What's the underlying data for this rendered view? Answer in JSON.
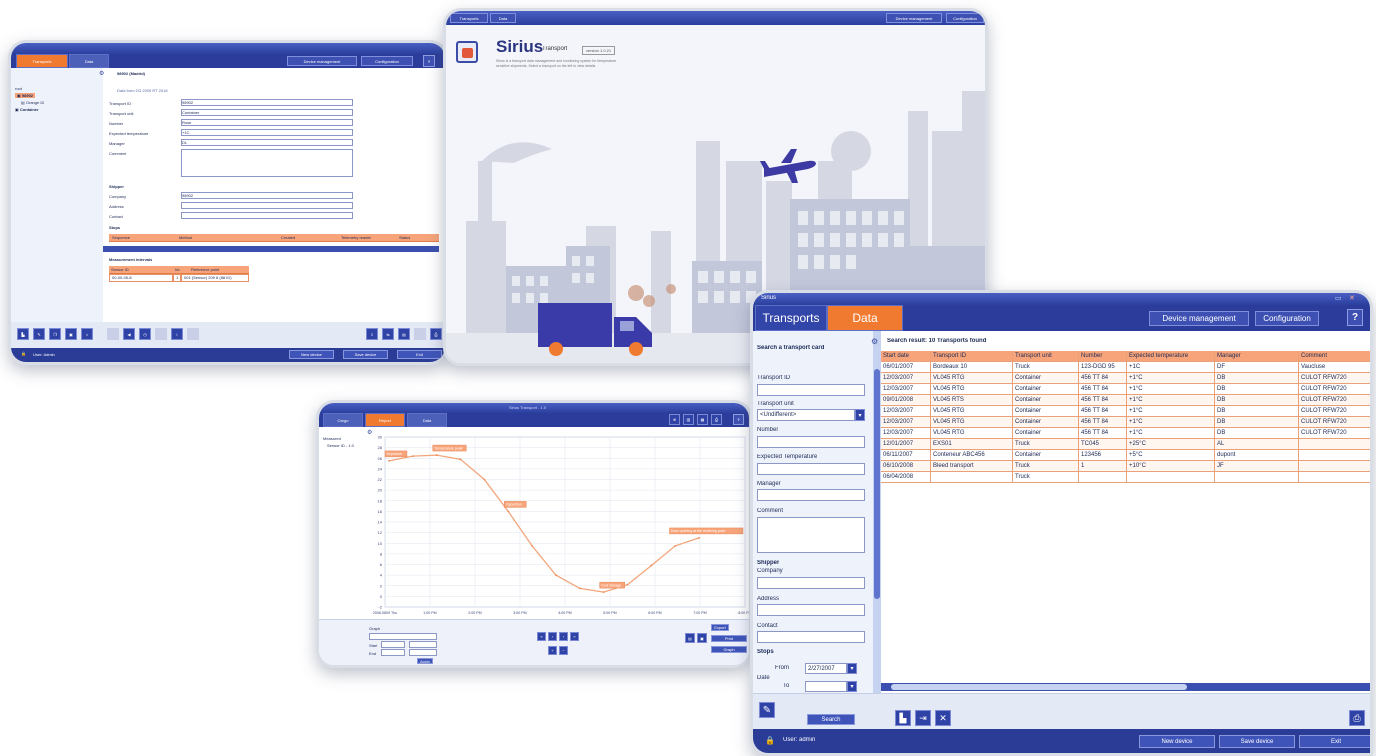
{
  "w1": {
    "tabs": [
      {
        "label": "Transports",
        "active": true
      },
      {
        "label": "Data",
        "active": false
      }
    ],
    "nav_buttons": [
      "Device management",
      "Configuration"
    ],
    "help": "?",
    "tree": [
      {
        "label": "root"
      },
      {
        "label": "98902"
      },
      {
        "label": "Orange ID"
      },
      {
        "label": "Container"
      }
    ],
    "form_title": "98902 (Madrid)",
    "form_subtitle": "Data from 2/3 2009 RT 2018",
    "fields": [
      {
        "label": "Transport ID",
        "value": "98902"
      },
      {
        "label": "Transport unit",
        "value": "Container"
      },
      {
        "label": "Number",
        "value": "Rose"
      },
      {
        "label": "Expected temperature",
        "value": "+1C"
      },
      {
        "label": "Manager",
        "value": "DL"
      },
      {
        "label": "Comment",
        "value": ""
      }
    ],
    "shipper_title": "Shipper",
    "shipper_fields": [
      {
        "label": "Company",
        "value": "98902"
      },
      {
        "label": "Address",
        "value": ""
      },
      {
        "label": "Contact",
        "value": ""
      }
    ],
    "stops_title": "Stops",
    "stops_headers": [
      "Sequence",
      "Method",
      "Created",
      "Telemetry reader",
      "Status"
    ],
    "measurement_title": "Measurement intervals",
    "measurement_headers": [
      "Sensor ID",
      "Int.",
      "Reference point"
    ],
    "measurement_row": [
      "00-00-05-8",
      "1",
      "001 (Sensor) 209 8 (88 ID)"
    ],
    "status_user": "User: Admin",
    "status_buttons": [
      "New device",
      "Save device",
      "Exit"
    ]
  },
  "w2": {
    "nav_left": [
      "Transports",
      "Data"
    ],
    "nav_right": [
      "Device management",
      "Configuration"
    ],
    "brand": "Sirius",
    "brand_sub": "Transport",
    "version": "version 1.0.21",
    "description": "Sirius is a transport data management and monitoring system for temperature sensitive shipments. Select a transport on the left to view details."
  },
  "w3": {
    "tabs": [
      {
        "label": "Cargo",
        "active": false
      },
      {
        "label": "Report",
        "active": true
      },
      {
        "label": "Data",
        "active": false
      }
    ],
    "title": "Sirius Transport - 1.0",
    "tree": [
      "Measured",
      "Sensor ID - 1.0"
    ],
    "y_ticks": [
      "30",
      "28",
      "26",
      "24",
      "22",
      "20",
      "18",
      "16",
      "14",
      "12",
      "10",
      "8",
      "6",
      "4",
      "2",
      "0",
      "-2"
    ],
    "x_ticks": [
      "2008-0809 Thu",
      "1:00 PM",
      "2:00 PM",
      "3:00 PM",
      "4:00 PM",
      "5:00 PM",
      "6:00 PM",
      "7:00 PM",
      "8:00 PM"
    ],
    "annotations": [
      "Departure",
      "Temperature peak",
      "Inspection",
      "Cool storage",
      "Door opening at the receiving point"
    ],
    "chart_data": {
      "type": "line",
      "series": [
        {
          "values": [
            25.5,
            26.4,
            26.6,
            25.8,
            22,
            16,
            9.5,
            4,
            1.5,
            0.8,
            2.2,
            5.8,
            9.5,
            11
          ]
        }
      ]
    },
    "bottom_labels": [
      "Graph",
      "Start",
      "End"
    ],
    "bottom_buttons": [
      "Apply",
      "Export",
      "Print",
      "Graph"
    ]
  },
  "w4": {
    "title": "Sirius",
    "tabs": [
      {
        "label": "Transports",
        "active": false
      },
      {
        "label": "Data",
        "active": true
      }
    ],
    "nav_buttons": [
      "Device management",
      "Configuration"
    ],
    "help": "?",
    "search_title": "Search a transport card",
    "search_fields": [
      {
        "label": "Transport ID",
        "value": ""
      },
      {
        "label": "Transport unit",
        "value": "<Undifferent>"
      },
      {
        "label": "Number",
        "value": ""
      },
      {
        "label": "Expected Temperature",
        "value": ""
      },
      {
        "label": "Manager",
        "value": ""
      },
      {
        "label": "Comment",
        "value": ""
      }
    ],
    "shipper_title": "Shipper",
    "shipper_fields": [
      {
        "label": "Company",
        "value": ""
      },
      {
        "label": "Address",
        "value": ""
      },
      {
        "label": "Contact",
        "value": ""
      }
    ],
    "stops_title": "Stops",
    "date_label": "Date",
    "from_label": "From",
    "from_value": "2/27/2007",
    "to_label": "To",
    "to_value": "",
    "search_button": "Search",
    "result_title": "Search result: 10 Transports found",
    "table": {
      "headers": [
        "Start date",
        "Transport ID",
        "Transport unit",
        "Number",
        "Expected temperature",
        "Manager",
        "Comment"
      ],
      "rows": [
        [
          "06/01/2007",
          "Bordeaux 10",
          "Truck",
          "123-DGD 95",
          "+1C",
          "DF",
          "Vaucluse"
        ],
        [
          "12/03/2007",
          "VL045 RTG",
          "Container",
          "456 TT 84",
          "+1°C",
          "DB",
          "CULOT RFW720"
        ],
        [
          "12/03/2007",
          "VL045 RTG",
          "Container",
          "456 TT 84",
          "+1°C",
          "DB",
          "CULOT RFW720"
        ],
        [
          "09/01/2008",
          "VL045 RTS",
          "Container",
          "456 TT 84",
          "+1°C",
          "DB",
          "CULOT RFW720"
        ],
        [
          "12/03/2007",
          "VL045 RTG",
          "Container",
          "456 TT 84",
          "+1°C",
          "DB",
          "CULOT RFW720"
        ],
        [
          "12/03/2007",
          "VL045 RTG",
          "Container",
          "456 TT 84",
          "+1°C",
          "DB",
          "CULOT RFW720"
        ],
        [
          "12/03/2007",
          "VL045 RTG",
          "Container",
          "456 TT 84",
          "+1°C",
          "DB",
          "CULOT RFW720"
        ],
        [
          "12/01/2007",
          "EXS01",
          "Truck",
          "TC045",
          "+25°C",
          "AL",
          ""
        ],
        [
          "06/11/2007",
          "Conteneur ABC456",
          "Container",
          "123456",
          "+5°C",
          "dupont",
          ""
        ],
        [
          "06/10/2008",
          "Bleed transport",
          "Truck",
          "1",
          "+10°C",
          "JF",
          ""
        ],
        [
          "06/04/2008",
          "",
          "Truck",
          "",
          "",
          "",
          ""
        ]
      ]
    },
    "user": "User: admin",
    "status_buttons": [
      "New device",
      "Save device",
      "Exit"
    ]
  }
}
